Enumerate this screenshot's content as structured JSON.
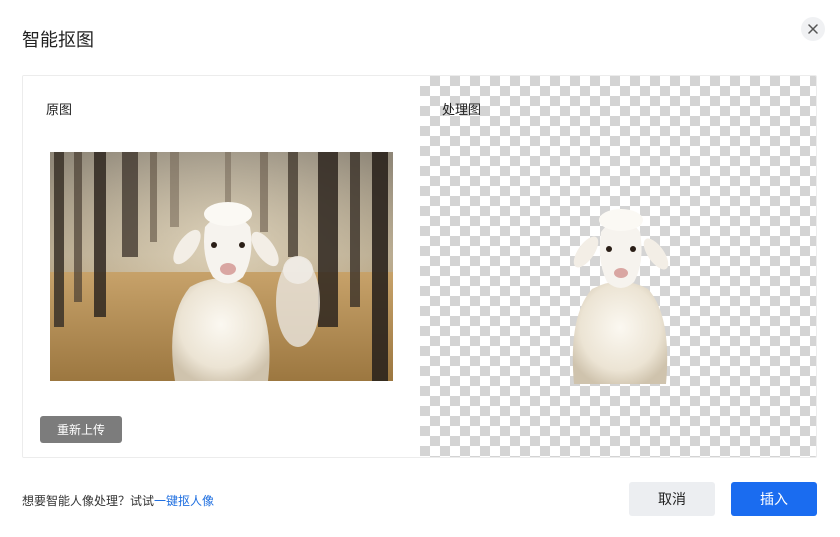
{
  "dialog": {
    "title": "智能抠图"
  },
  "panels": {
    "original_label": "原图",
    "processed_label": "处理图"
  },
  "buttons": {
    "reupload": "重新上传",
    "cancel": "取消",
    "insert": "插入"
  },
  "footer": {
    "hint_text": "想要智能人像处理？试试",
    "hint_link": "一键抠人像"
  },
  "icons": {
    "close": "close-icon"
  },
  "colors": {
    "primary": "#1a6cf0",
    "link": "#1f6fe0",
    "reupload_bg": "#7c7c7c",
    "cancel_bg": "#eceef1"
  }
}
